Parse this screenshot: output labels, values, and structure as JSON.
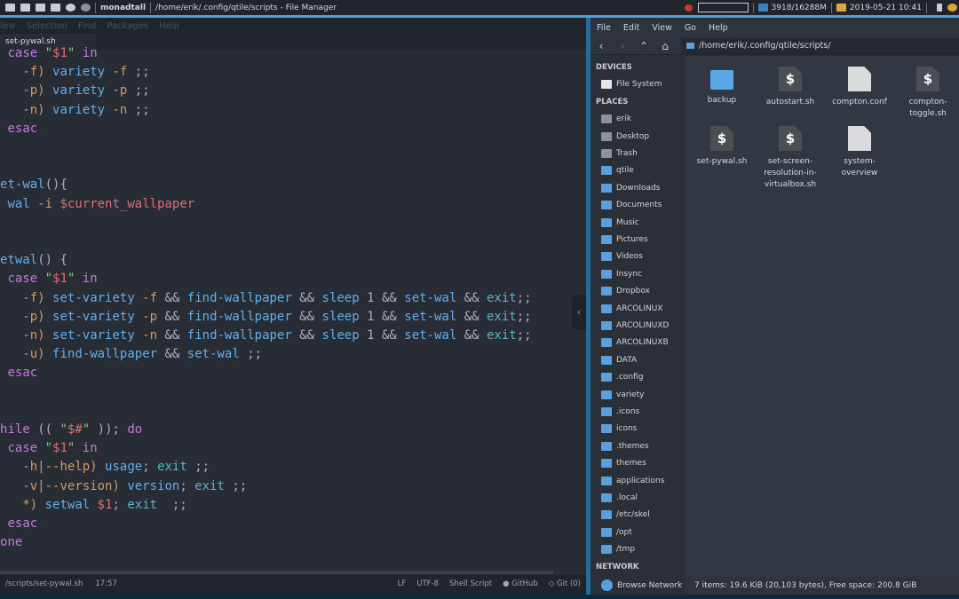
{
  "topbar": {
    "layout": "monadtall",
    "window_title": "/home/erik/.config/qtile/scripts - File Manager",
    "memory": "3918/16288M",
    "datetime": "2019-05-21 10:41",
    "icons": [
      "image-icon",
      "video-icon",
      "laptop-icon",
      "folder-icon",
      "telegram-icon",
      "paw-icon"
    ]
  },
  "editor": {
    "menu": [
      "View",
      "Selection",
      "Find",
      "Packages",
      "Help"
    ],
    "tab": "set-pywal.sh",
    "code": [
      [
        [
          "  ",
          "p"
        ],
        [
          "case",
          "k"
        ],
        [
          " ",
          "p"
        ],
        [
          "\"",
          "s"
        ],
        [
          "$1",
          "v"
        ],
        [
          "\"",
          "s"
        ],
        [
          " in",
          "k"
        ]
      ],
      [
        [
          "    -f) ",
          "a"
        ],
        [
          "variety",
          "c"
        ],
        [
          " -f",
          "a"
        ],
        [
          " ;;",
          "p"
        ]
      ],
      [
        [
          "    -p) ",
          "a"
        ],
        [
          "variety",
          "c"
        ],
        [
          " -p",
          "a"
        ],
        [
          " ;;",
          "p"
        ]
      ],
      [
        [
          "    -n) ",
          "a"
        ],
        [
          "variety",
          "c"
        ],
        [
          " -n",
          "a"
        ],
        [
          " ;;",
          "p"
        ]
      ],
      [
        [
          "  ",
          "p"
        ],
        [
          "esac",
          "k"
        ]
      ],
      [
        [
          "",
          "p"
        ]
      ],
      [
        [
          "",
          "p"
        ]
      ],
      [
        [
          "set-wal",
          "c"
        ],
        [
          "(){",
          "p"
        ]
      ],
      [
        [
          "  ",
          "p"
        ],
        [
          "wal",
          "c"
        ],
        [
          " -i ",
          "a"
        ],
        [
          "$current_wallpaper",
          "v"
        ]
      ],
      [
        [
          "",
          "p"
        ]
      ],
      [
        [
          "",
          "p"
        ]
      ],
      [
        [
          "setwal",
          "c"
        ],
        [
          "() {",
          "p"
        ]
      ],
      [
        [
          "  ",
          "p"
        ],
        [
          "case",
          "k"
        ],
        [
          " ",
          "p"
        ],
        [
          "\"",
          "s"
        ],
        [
          "$1",
          "v"
        ],
        [
          "\"",
          "s"
        ],
        [
          " in",
          "k"
        ]
      ],
      [
        [
          "    -f) ",
          "a"
        ],
        [
          "set-variety",
          "c"
        ],
        [
          " -f ",
          "a"
        ],
        [
          "&& ",
          "p"
        ],
        [
          "find-wallpaper",
          "c"
        ],
        [
          " && ",
          "p"
        ],
        [
          "sleep",
          "c"
        ],
        [
          " 1 ",
          "p"
        ],
        [
          "&& ",
          "p"
        ],
        [
          "set-wal",
          "c"
        ],
        [
          " && ",
          "p"
        ],
        [
          "exit",
          "e"
        ],
        [
          ";;",
          "p"
        ]
      ],
      [
        [
          "    -p) ",
          "a"
        ],
        [
          "set-variety",
          "c"
        ],
        [
          " -p ",
          "a"
        ],
        [
          "&& ",
          "p"
        ],
        [
          "find-wallpaper",
          "c"
        ],
        [
          " && ",
          "p"
        ],
        [
          "sleep",
          "c"
        ],
        [
          " 1 ",
          "p"
        ],
        [
          "&& ",
          "p"
        ],
        [
          "set-wal",
          "c"
        ],
        [
          " && ",
          "p"
        ],
        [
          "exit",
          "e"
        ],
        [
          ";;",
          "p"
        ]
      ],
      [
        [
          "    -n) ",
          "a"
        ],
        [
          "set-variety",
          "c"
        ],
        [
          " -n ",
          "a"
        ],
        [
          "&& ",
          "p"
        ],
        [
          "find-wallpaper",
          "c"
        ],
        [
          " && ",
          "p"
        ],
        [
          "sleep",
          "c"
        ],
        [
          " 1 ",
          "p"
        ],
        [
          "&& ",
          "p"
        ],
        [
          "set-wal",
          "c"
        ],
        [
          " && ",
          "p"
        ],
        [
          "exit",
          "e"
        ],
        [
          ";;",
          "p"
        ]
      ],
      [
        [
          "    -u) ",
          "a"
        ],
        [
          "find-wallpaper",
          "c"
        ],
        [
          " && ",
          "p"
        ],
        [
          "set-wal",
          "c"
        ],
        [
          " ;;",
          "p"
        ]
      ],
      [
        [
          "  ",
          "p"
        ],
        [
          "esac",
          "k"
        ]
      ],
      [
        [
          "",
          "p"
        ]
      ],
      [
        [
          "",
          "p"
        ]
      ],
      [
        [
          "while",
          "k"
        ],
        [
          " (( ",
          "p"
        ],
        [
          "\"",
          "s"
        ],
        [
          "$#",
          "v"
        ],
        [
          "\"",
          "s"
        ],
        [
          " )); ",
          "p"
        ],
        [
          "do",
          "k"
        ]
      ],
      [
        [
          "  ",
          "p"
        ],
        [
          "case",
          "k"
        ],
        [
          " ",
          "p"
        ],
        [
          "\"",
          "s"
        ],
        [
          "$1",
          "v"
        ],
        [
          "\"",
          "s"
        ],
        [
          " in",
          "k"
        ]
      ],
      [
        [
          "    -h|--help) ",
          "a"
        ],
        [
          "usage",
          "c"
        ],
        [
          "; ",
          "p"
        ],
        [
          "exit",
          "e"
        ],
        [
          " ;;",
          "p"
        ]
      ],
      [
        [
          "    -v|--version) ",
          "a"
        ],
        [
          "version",
          "c"
        ],
        [
          "; ",
          "p"
        ],
        [
          "exit",
          "e"
        ],
        [
          " ;;",
          "p"
        ]
      ],
      [
        [
          "    *) ",
          "a"
        ],
        [
          "setwal",
          "c"
        ],
        [
          " $1",
          "v"
        ],
        [
          "; ",
          "p"
        ],
        [
          "exit",
          "e"
        ],
        [
          "  ;;",
          "p"
        ]
      ],
      [
        [
          "  ",
          "p"
        ],
        [
          "esac",
          "k"
        ]
      ],
      [
        [
          "done",
          "k"
        ]
      ]
    ],
    "status": {
      "file": "/scripts/set-pywal.sh",
      "cursor": "17:57",
      "line_ending": "LF",
      "encoding": "UTF-8",
      "grammar": "Shell Script",
      "github": "GitHub",
      "git": "Git (0)"
    }
  },
  "file_manager": {
    "menu": [
      "File",
      "Edit",
      "View",
      "Go",
      "Help"
    ],
    "path": "/home/erik/.config/qtile/scripts/",
    "sections": {
      "devices": "DEVICES",
      "places": "PLACES",
      "network": "NETWORK"
    },
    "devices": [
      "File System"
    ],
    "places": [
      "erik",
      "Desktop",
      "Trash",
      "qtile",
      "Downloads",
      "Documents",
      "Music",
      "Pictures",
      "Videos",
      "Insync",
      "Dropbox",
      "ARCOLINUX",
      "ARCOLINUXD",
      "ARCOLINUXB",
      "DATA",
      ".config",
      "variety",
      ".icons",
      "icons",
      ".themes",
      "themes",
      "applications",
      ".local",
      "/etc/skel",
      "/opt",
      "/tmp"
    ],
    "network": [
      "Browse Network"
    ],
    "items": [
      {
        "name": "backup",
        "type": "folder"
      },
      {
        "name": "autostart.sh",
        "type": "script"
      },
      {
        "name": "compton.conf",
        "type": "doc"
      },
      {
        "name": "compton-toggle.sh",
        "type": "script"
      },
      {
        "name": "set-pywal.sh",
        "type": "script"
      },
      {
        "name": "set-screen-resolution-in-virtualbox.sh",
        "type": "script"
      },
      {
        "name": "system-overview",
        "type": "doc"
      }
    ],
    "status": "7 items: 19.6 KiB (20,103 bytes), Free space: 200.8 GiB"
  }
}
